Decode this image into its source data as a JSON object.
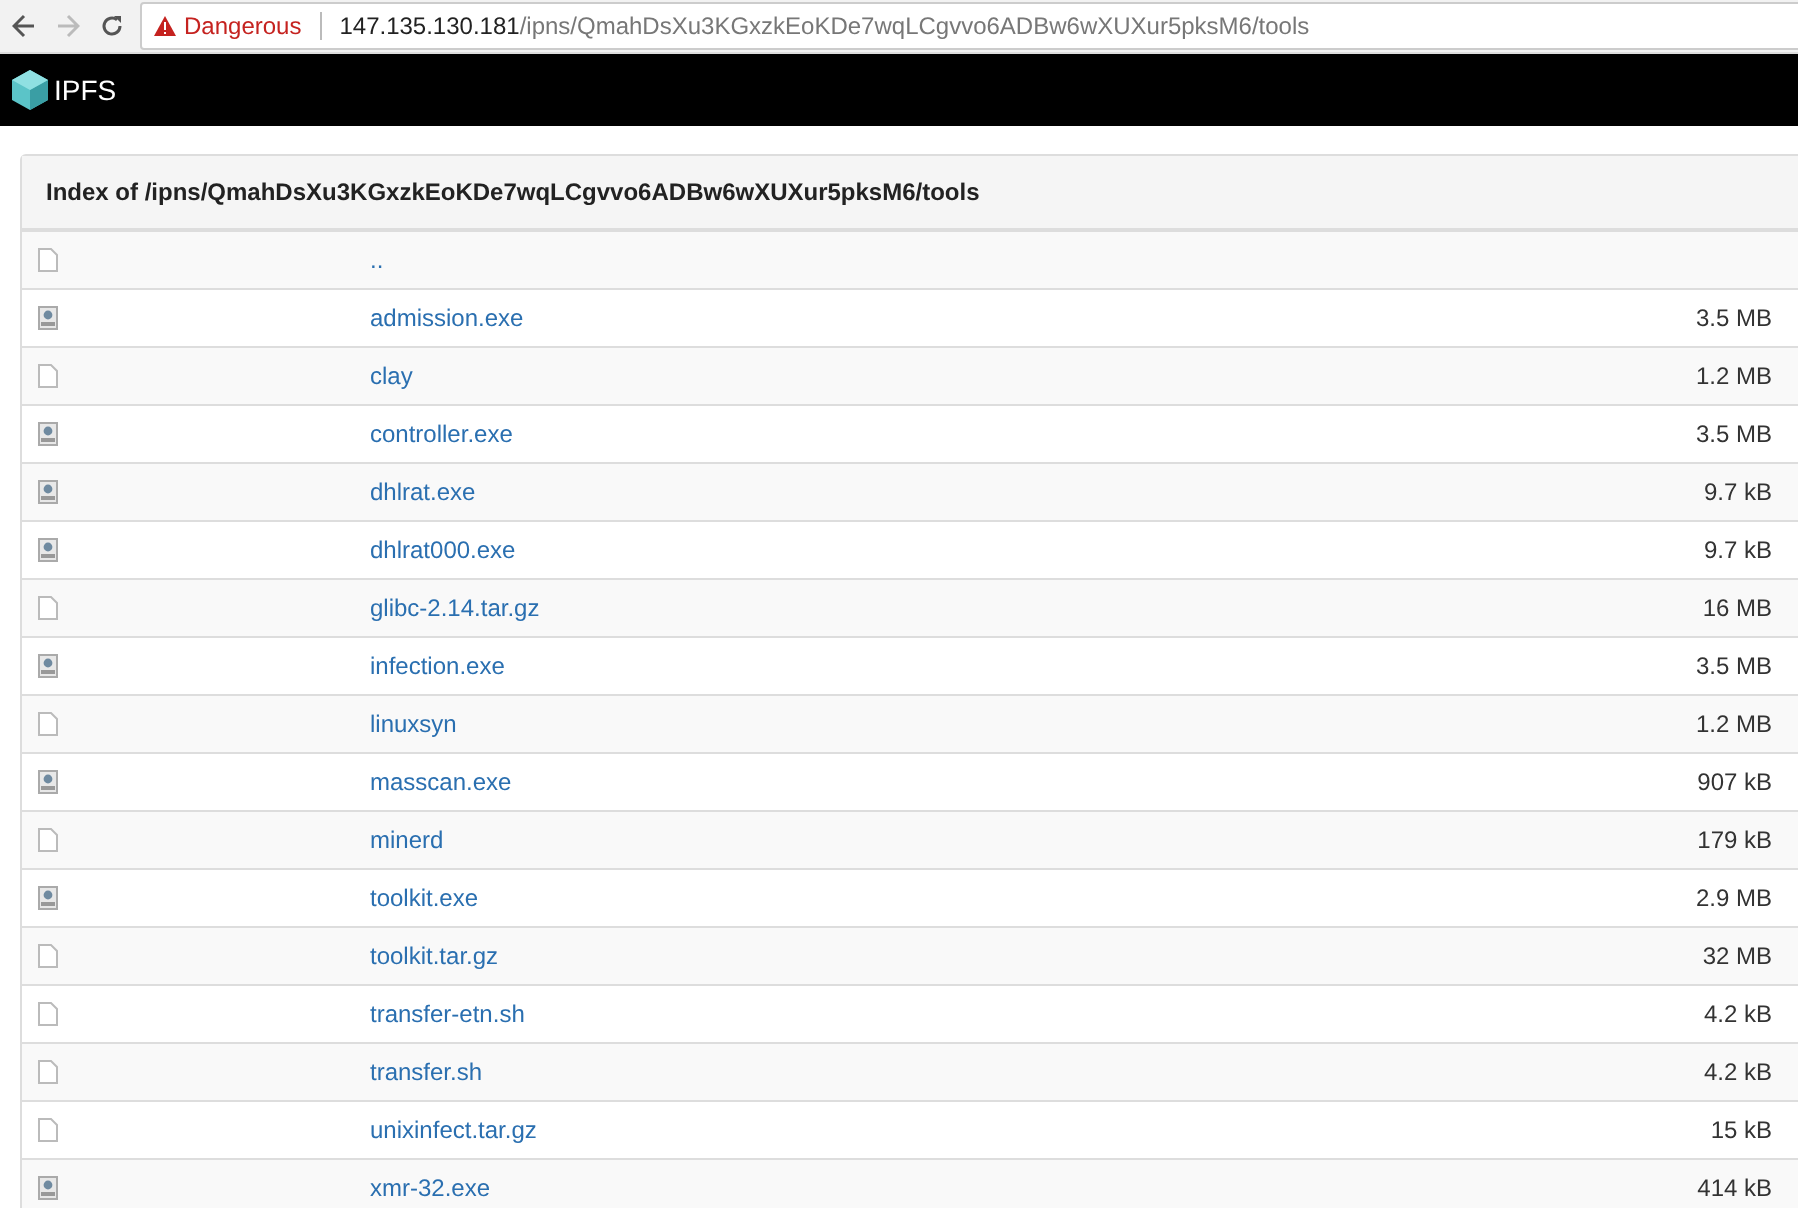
{
  "browser": {
    "security_label": "Dangerous",
    "url_host": "147.135.130.181",
    "url_path": "/ipns/QmahDsXu3KGxzkEoKDe7wqLCgvvo6ADBw6wXUXur5pksM6/tools"
  },
  "header": {
    "brand": "IPFS"
  },
  "listing": {
    "title": "Index of /ipns/QmahDsXu3KGxzkEoKDe7wqLCgvvo6ADBw6wXUXur5pksM6/tools",
    "rows": [
      {
        "kind": "file",
        "name": ".."
      },
      {
        "kind": "exe",
        "name": "admission.exe",
        "size": "3.5 MB"
      },
      {
        "kind": "file",
        "name": "clay",
        "size": "1.2 MB"
      },
      {
        "kind": "exe",
        "name": "controller.exe",
        "size": "3.5 MB"
      },
      {
        "kind": "exe",
        "name": "dhlrat.exe",
        "size": "9.7 kB"
      },
      {
        "kind": "exe",
        "name": "dhlrat000.exe",
        "size": "9.7 kB"
      },
      {
        "kind": "file",
        "name": "glibc-2.14.tar.gz",
        "size": "16 MB"
      },
      {
        "kind": "exe",
        "name": "infection.exe",
        "size": "3.5 MB"
      },
      {
        "kind": "file",
        "name": "linuxsyn",
        "size": "1.2 MB"
      },
      {
        "kind": "exe",
        "name": "masscan.exe",
        "size": "907 kB"
      },
      {
        "kind": "file",
        "name": "minerd",
        "size": "179 kB"
      },
      {
        "kind": "exe",
        "name": "toolkit.exe",
        "size": "2.9 MB"
      },
      {
        "kind": "file",
        "name": "toolkit.tar.gz",
        "size": "32 MB"
      },
      {
        "kind": "file",
        "name": "transfer-etn.sh",
        "size": "4.2 kB"
      },
      {
        "kind": "file",
        "name": "transfer.sh",
        "size": "4.2 kB"
      },
      {
        "kind": "file",
        "name": "unixinfect.tar.gz",
        "size": "15 kB"
      },
      {
        "kind": "exe",
        "name": "xmr-32.exe",
        "size": "414 kB"
      }
    ]
  }
}
